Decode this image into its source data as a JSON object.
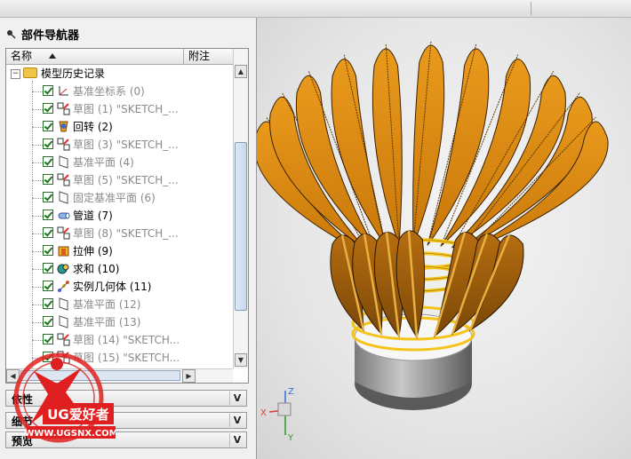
{
  "panel": {
    "title": "部件导航器",
    "columns": [
      "名称",
      "附注"
    ],
    "root_label": "模型历史记录",
    "sections": [
      "依性",
      "细节",
      "预览"
    ]
  },
  "features": [
    {
      "label": "基准坐标系 (0)",
      "state": "grey",
      "icon": "datum-csys-icon"
    },
    {
      "label": "草图 (1) \"SKETCH_...",
      "state": "grey",
      "icon": "sketch-icon"
    },
    {
      "label": "回转 (2)",
      "state": "dark",
      "icon": "revolve-icon"
    },
    {
      "label": "草图 (3) \"SKETCH_...",
      "state": "grey",
      "icon": "sketch-icon"
    },
    {
      "label": "基准平面 (4)",
      "state": "grey",
      "icon": "datum-plane-icon"
    },
    {
      "label": "草图 (5) \"SKETCH_...",
      "state": "grey",
      "icon": "sketch-icon"
    },
    {
      "label": "固定基准平面 (6)",
      "state": "grey",
      "icon": "fixed-datum-plane-icon"
    },
    {
      "label": "管道 (7)",
      "state": "dark",
      "icon": "tube-icon"
    },
    {
      "label": "草图 (8) \"SKETCH_...",
      "state": "grey",
      "icon": "sketch-icon"
    },
    {
      "label": "拉伸 (9)",
      "state": "dark",
      "icon": "extrude-icon"
    },
    {
      "label": "求和 (10)",
      "state": "dark",
      "icon": "unite-icon"
    },
    {
      "label": "实例几何体 (11)",
      "state": "dark",
      "icon": "instance-geometry-icon"
    },
    {
      "label": "基准平面 (12)",
      "state": "grey",
      "icon": "datum-plane-icon"
    },
    {
      "label": "基准平面 (13)",
      "state": "grey",
      "icon": "datum-plane-icon"
    },
    {
      "label": "草图 (14) \"SKETCH...",
      "state": "grey",
      "icon": "sketch-icon"
    },
    {
      "label": "草图 (15) \"SKETCH...",
      "state": "grey",
      "icon": "sketch-icon"
    }
  ],
  "watermark": {
    "brand": "UG爱好者",
    "url": "WWW.UGSNX.COM"
  },
  "triad": {
    "x": "X",
    "y": "Y",
    "z": "Z"
  },
  "colors": {
    "feather": "#d98a10",
    "ring": "#f5c41a",
    "accent_red": "#e02020"
  }
}
